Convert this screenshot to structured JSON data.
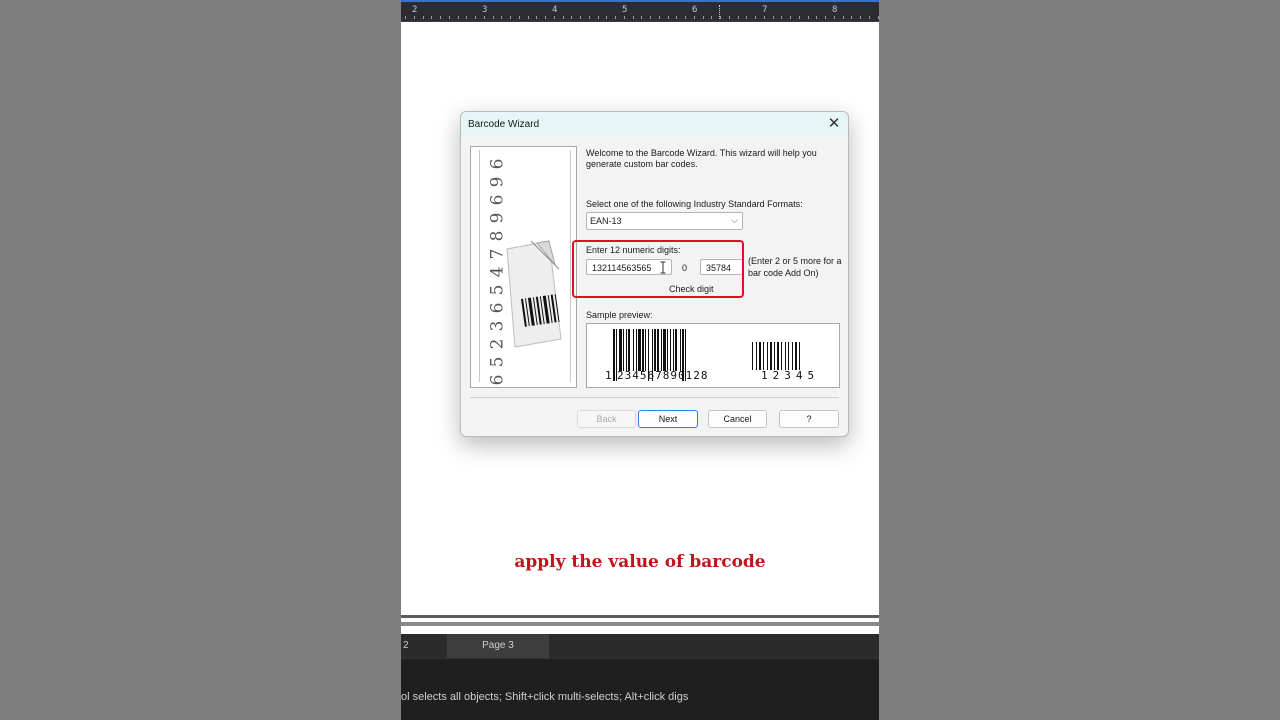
{
  "ruler": {
    "numbers": [
      "2",
      "3",
      "4",
      "5",
      "6",
      "7",
      "8"
    ]
  },
  "dialog": {
    "title": "Barcode Wizard",
    "close_glyph": "✕",
    "art_digits": [
      "6",
      "9",
      "6",
      "9",
      "8",
      "7",
      "4",
      "5",
      "6",
      "3",
      "2",
      "5",
      "6"
    ],
    "welcome_text": "Welcome to the Barcode Wizard.  This wizard will help you generate custom bar codes.",
    "format_label": "Select one of the following Industry Standard Formats:",
    "format_selected": "EAN-13",
    "digits_label": "Enter 12 numeric digits:",
    "digits_value": "132114563565",
    "check_digit_value": "0",
    "addon_value": "35784",
    "addon_hint": "(Enter 2 or 5 more for a bar code Add On)",
    "check_digit_label": "Check digit",
    "preview_label": "Sample preview:",
    "preview_main_first": "1",
    "preview_main_digits": "234567890128",
    "preview_addon_digits": "12345",
    "buttons": {
      "back": "Back",
      "next": "Next",
      "cancel": "Cancel",
      "help": "?"
    }
  },
  "annotation": {
    "color": "#e10f22"
  },
  "caption": "apply the value of barcode",
  "tabs": [
    {
      "label": "2",
      "active": false
    },
    {
      "label": "Page 3",
      "active": true
    }
  ],
  "status_text": "ol selects all objects; Shift+click multi-selects; Alt+click digs"
}
